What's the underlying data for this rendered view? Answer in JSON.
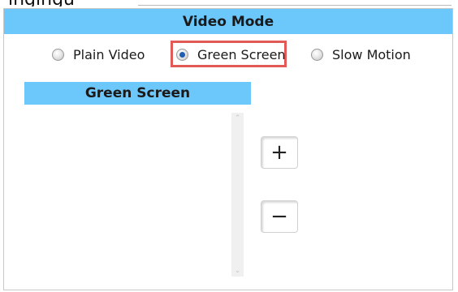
{
  "top_strip": {
    "partial_text": "ingingu"
  },
  "header": {
    "title": "Video Mode"
  },
  "modes": [
    {
      "label": "Plain Video",
      "selected": false
    },
    {
      "label": "Green Screen",
      "selected": true
    },
    {
      "label": "Slow Motion",
      "selected": false
    }
  ],
  "section": {
    "title": "Green Screen"
  },
  "list": {
    "items": []
  },
  "scrollbar": {
    "up_glyph": "⌃",
    "down_glyph": "⌄"
  },
  "controls": {
    "plus_label": "+",
    "minus_label": "−"
  },
  "colors": {
    "header_bg": "#6cc7fb",
    "highlight_border": "#e25a55",
    "radio_selected": "#1f5fb3"
  }
}
